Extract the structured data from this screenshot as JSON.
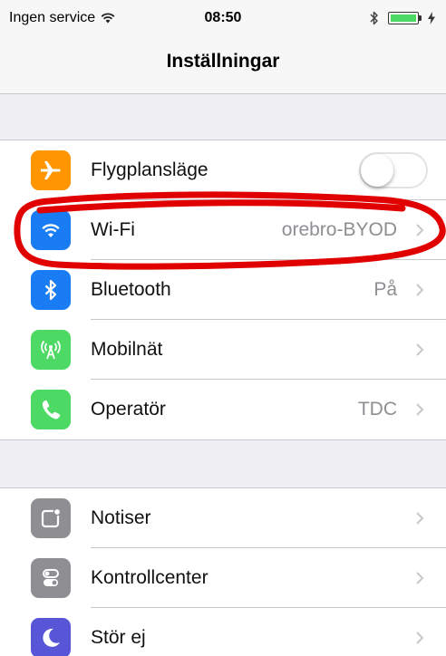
{
  "status": {
    "carrier": "Ingen service",
    "time": "08:50",
    "battery_level": 1.0,
    "icons": [
      "wifi-signal-icon",
      "bluetooth-icon",
      "battery-icon",
      "charging-bolt-icon"
    ]
  },
  "nav": {
    "title": "Inställningar"
  },
  "groups": [
    {
      "items": [
        {
          "id": "airplane",
          "label": "Flygplansläge",
          "icon": "airplane-icon",
          "icon_color": "#ff9500",
          "control": "toggle",
          "toggle_on": false
        },
        {
          "id": "wifi",
          "label": "Wi-Fi",
          "detail": "orebro-BYOD",
          "icon": "wifi-icon",
          "icon_color": "#1a7cf3",
          "control": "chevron"
        },
        {
          "id": "bluetooth",
          "label": "Bluetooth",
          "detail": "På",
          "icon": "bluetooth-icon",
          "icon_color": "#1a7cf3",
          "control": "chevron"
        },
        {
          "id": "cellular",
          "label": "Mobilnät",
          "detail": "",
          "icon": "antenna-icon",
          "icon_color": "#4cd964",
          "control": "chevron"
        },
        {
          "id": "carrier",
          "label": "Operatör",
          "detail": "TDC",
          "icon": "phone-icon",
          "icon_color": "#4cd964",
          "control": "chevron"
        }
      ]
    },
    {
      "items": [
        {
          "id": "notifications",
          "label": "Notiser",
          "icon": "notifications-icon",
          "icon_color": "#8e8e93",
          "control": "chevron"
        },
        {
          "id": "control-center",
          "label": "Kontrollcenter",
          "icon": "control-center-icon",
          "icon_color": "#8e8e93",
          "control": "chevron"
        },
        {
          "id": "dnd",
          "label": "Stör ej",
          "icon": "moon-icon",
          "icon_color": "#5856d6",
          "control": "chevron"
        }
      ]
    }
  ],
  "annotation": {
    "color": "#e00000"
  }
}
